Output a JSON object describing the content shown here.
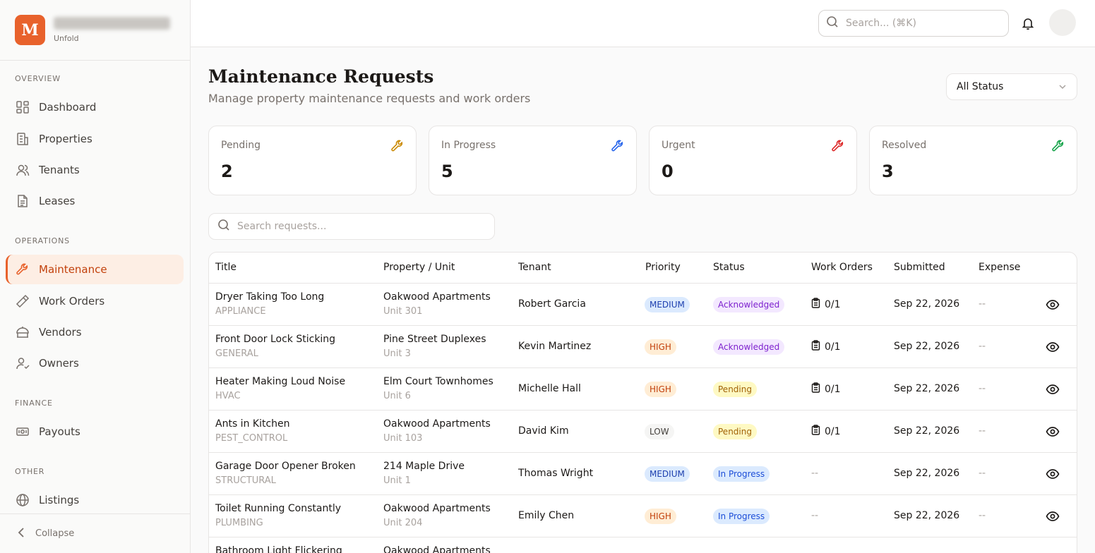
{
  "brand": {
    "logo_letter": "M",
    "name": "Midland Bay Prop...",
    "subtitle": "Unfold"
  },
  "sidebar": {
    "sections": [
      "OVERVIEW",
      "OPERATIONS",
      "FINANCE",
      "OTHER"
    ],
    "items": [
      {
        "label": "Dashboard",
        "icon": "dashboard-icon"
      },
      {
        "label": "Properties",
        "icon": "building-icon"
      },
      {
        "label": "Tenants",
        "icon": "users-icon"
      },
      {
        "label": "Leases",
        "icon": "document-icon"
      },
      {
        "label": "Maintenance",
        "icon": "wrench-icon",
        "active": true
      },
      {
        "label": "Work Orders",
        "icon": "hammer-icon"
      },
      {
        "label": "Vendors",
        "icon": "store-icon"
      },
      {
        "label": "Owners",
        "icon": "user-check-icon"
      },
      {
        "label": "Payouts",
        "icon": "cash-icon"
      },
      {
        "label": "Listings",
        "icon": "globe-icon"
      }
    ],
    "collapse_label": "Collapse"
  },
  "topbar": {
    "search_placeholder": "Search... (⌘K)"
  },
  "page": {
    "title": "Maintenance Requests",
    "subtitle": "Manage property maintenance requests and work orders",
    "status_filter": "All Status"
  },
  "stats": [
    {
      "label": "Pending",
      "value": "2",
      "color": "#ca8a04"
    },
    {
      "label": "In Progress",
      "value": "5",
      "color": "#2563eb"
    },
    {
      "label": "Urgent",
      "value": "0",
      "color": "#dc2626"
    },
    {
      "label": "Resolved",
      "value": "3",
      "color": "#16a34a"
    }
  ],
  "requests_search_placeholder": "Search requests...",
  "table": {
    "columns": [
      "Title",
      "Property / Unit",
      "Tenant",
      "Priority",
      "Status",
      "Work Orders",
      "Submitted",
      "Expense"
    ],
    "rows": [
      {
        "title": "Dryer Taking Too Long",
        "category": "APPLIANCE",
        "property": "Oakwood Apartments",
        "unit": "Unit 301",
        "tenant": "Robert Garcia",
        "priority": "MEDIUM",
        "status": "Acknowledged",
        "work_orders": "0/1",
        "submitted": "Sep 22, 2026",
        "expense": "--"
      },
      {
        "title": "Front Door Lock Sticking",
        "category": "GENERAL",
        "property": "Pine Street Duplexes",
        "unit": "Unit 3",
        "tenant": "Kevin Martinez",
        "priority": "HIGH",
        "status": "Acknowledged",
        "work_orders": "0/1",
        "submitted": "Sep 22, 2026",
        "expense": "--"
      },
      {
        "title": "Heater Making Loud Noise",
        "category": "HVAC",
        "property": "Elm Court Townhomes",
        "unit": "Unit 6",
        "tenant": "Michelle Hall",
        "priority": "HIGH",
        "status": "Pending",
        "work_orders": "0/1",
        "submitted": "Sep 22, 2026",
        "expense": "--"
      },
      {
        "title": "Ants in Kitchen",
        "category": "PEST_CONTROL",
        "property": "Oakwood Apartments",
        "unit": "Unit 103",
        "tenant": "David Kim",
        "priority": "LOW",
        "status": "Pending",
        "work_orders": "0/1",
        "submitted": "Sep 22, 2026",
        "expense": "--"
      },
      {
        "title": "Garage Door Opener Broken",
        "category": "STRUCTURAL",
        "property": "214 Maple Drive",
        "unit": "Unit 1",
        "tenant": "Thomas Wright",
        "priority": "MEDIUM",
        "status": "In Progress",
        "work_orders": "--",
        "submitted": "Sep 22, 2026",
        "expense": "--"
      },
      {
        "title": "Toilet Running Constantly",
        "category": "PLUMBING",
        "property": "Oakwood Apartments",
        "unit": "Unit 204",
        "tenant": "Emily Chen",
        "priority": "HIGH",
        "status": "In Progress",
        "work_orders": "--",
        "submitted": "Sep 22, 2026",
        "expense": "--"
      },
      {
        "title": "Bathroom Light Flickering",
        "category": "",
        "property": "Oakwood Apartments",
        "unit": "",
        "tenant": "",
        "priority": "",
        "status": "",
        "work_orders": "",
        "submitted": "",
        "expense": ""
      }
    ]
  },
  "colors": {
    "accent": "#e8622c",
    "priority": {
      "MEDIUM": [
        "#dbeafe",
        "#1e40af"
      ],
      "HIGH": [
        "#ffedd5",
        "#c2410c"
      ],
      "LOW": [
        "#f5f5f4",
        "#44403c"
      ]
    },
    "status": {
      "Acknowledged": [
        "#f3e8ff",
        "#7e22ce"
      ],
      "Pending": [
        "#fef9c3",
        "#a16207"
      ],
      "In Progress": [
        "#dbeafe",
        "#1d4ed8"
      ]
    }
  }
}
